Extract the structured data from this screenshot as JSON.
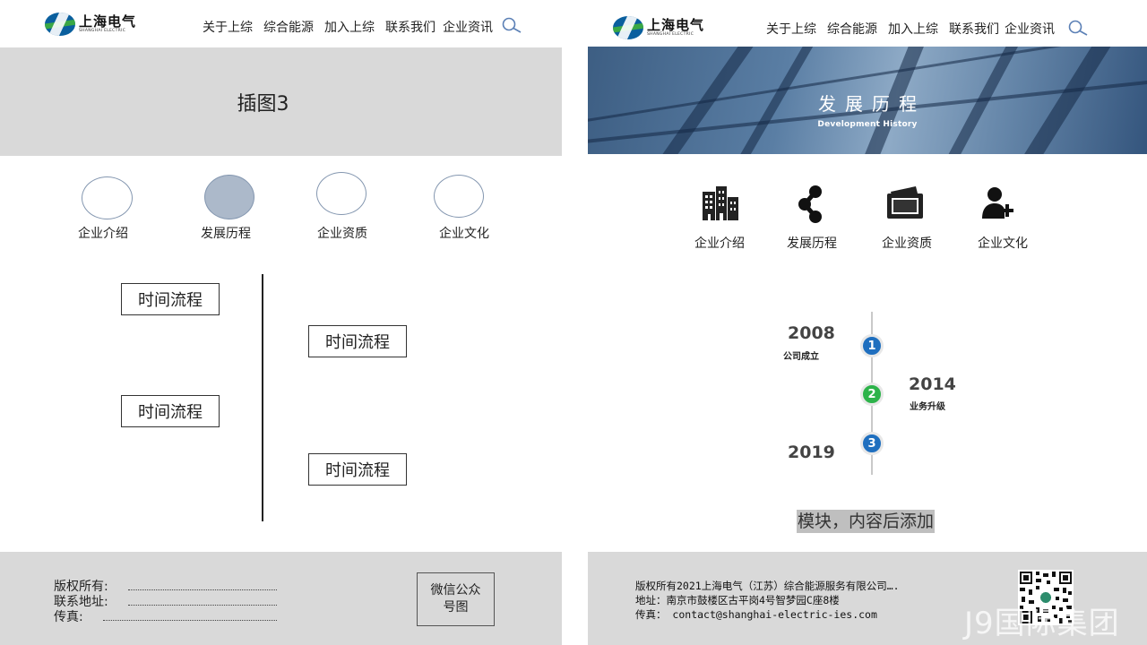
{
  "brand": {
    "name_cn": "上海电气",
    "name_en": "SHANGHAI ELECTRIC"
  },
  "colors": {
    "placeholder_gray": "#d9d9d9",
    "circle_border": "#8497b0",
    "circle_active": "#acb9ca",
    "step1": "#1f6fbf",
    "step2": "#2db34a",
    "step3": "#1f6fbf"
  },
  "nav": {
    "items": [
      "关于上综",
      "综合能源",
      "加入上综",
      "联系我们",
      "企业资讯"
    ],
    "search_icon": "search-icon"
  },
  "left": {
    "banner_placeholder": "插图3",
    "categories": [
      {
        "label": "企业介绍",
        "active": false
      },
      {
        "label": "发展历程",
        "active": true
      },
      {
        "label": "企业资质",
        "active": false
      },
      {
        "label": "企业文化",
        "active": false
      }
    ],
    "timeline_boxes": [
      "时间流程",
      "时间流程",
      "时间流程",
      "时间流程"
    ],
    "footer": {
      "copyright_label": "版权所有:",
      "address_label": "联系地址:",
      "fax_label": "传真:",
      "qr_placeholder_line1": "微信公众",
      "qr_placeholder_line2": "号图"
    }
  },
  "right": {
    "banner": {
      "title": "发展历程",
      "subtitle": "Development History"
    },
    "categories": [
      {
        "label": "企业介绍",
        "icon": "buildings-icon"
      },
      {
        "label": "发展历程",
        "icon": "share-nodes-icon"
      },
      {
        "label": "企业资质",
        "icon": "certificate-icon"
      },
      {
        "label": "企业文化",
        "icon": "user-plus-icon"
      }
    ],
    "timeline": [
      {
        "step": "1",
        "year": "2008",
        "note": "公司成立"
      },
      {
        "step": "2",
        "year": "2014",
        "note": "业务升级"
      },
      {
        "step": "3",
        "year": "2019",
        "note": ""
      }
    ],
    "module_note": "模块，内容后添加",
    "footer": {
      "copyright": "版权所有2021上海电气（江苏）综合能源服务有限公司….",
      "address": "地址：南京市鼓楼区古平岗4号智梦园C座8楼",
      "fax": "传真：  contact@shanghai-electric-ies.com",
      "watermark": "J9国际集团"
    }
  }
}
